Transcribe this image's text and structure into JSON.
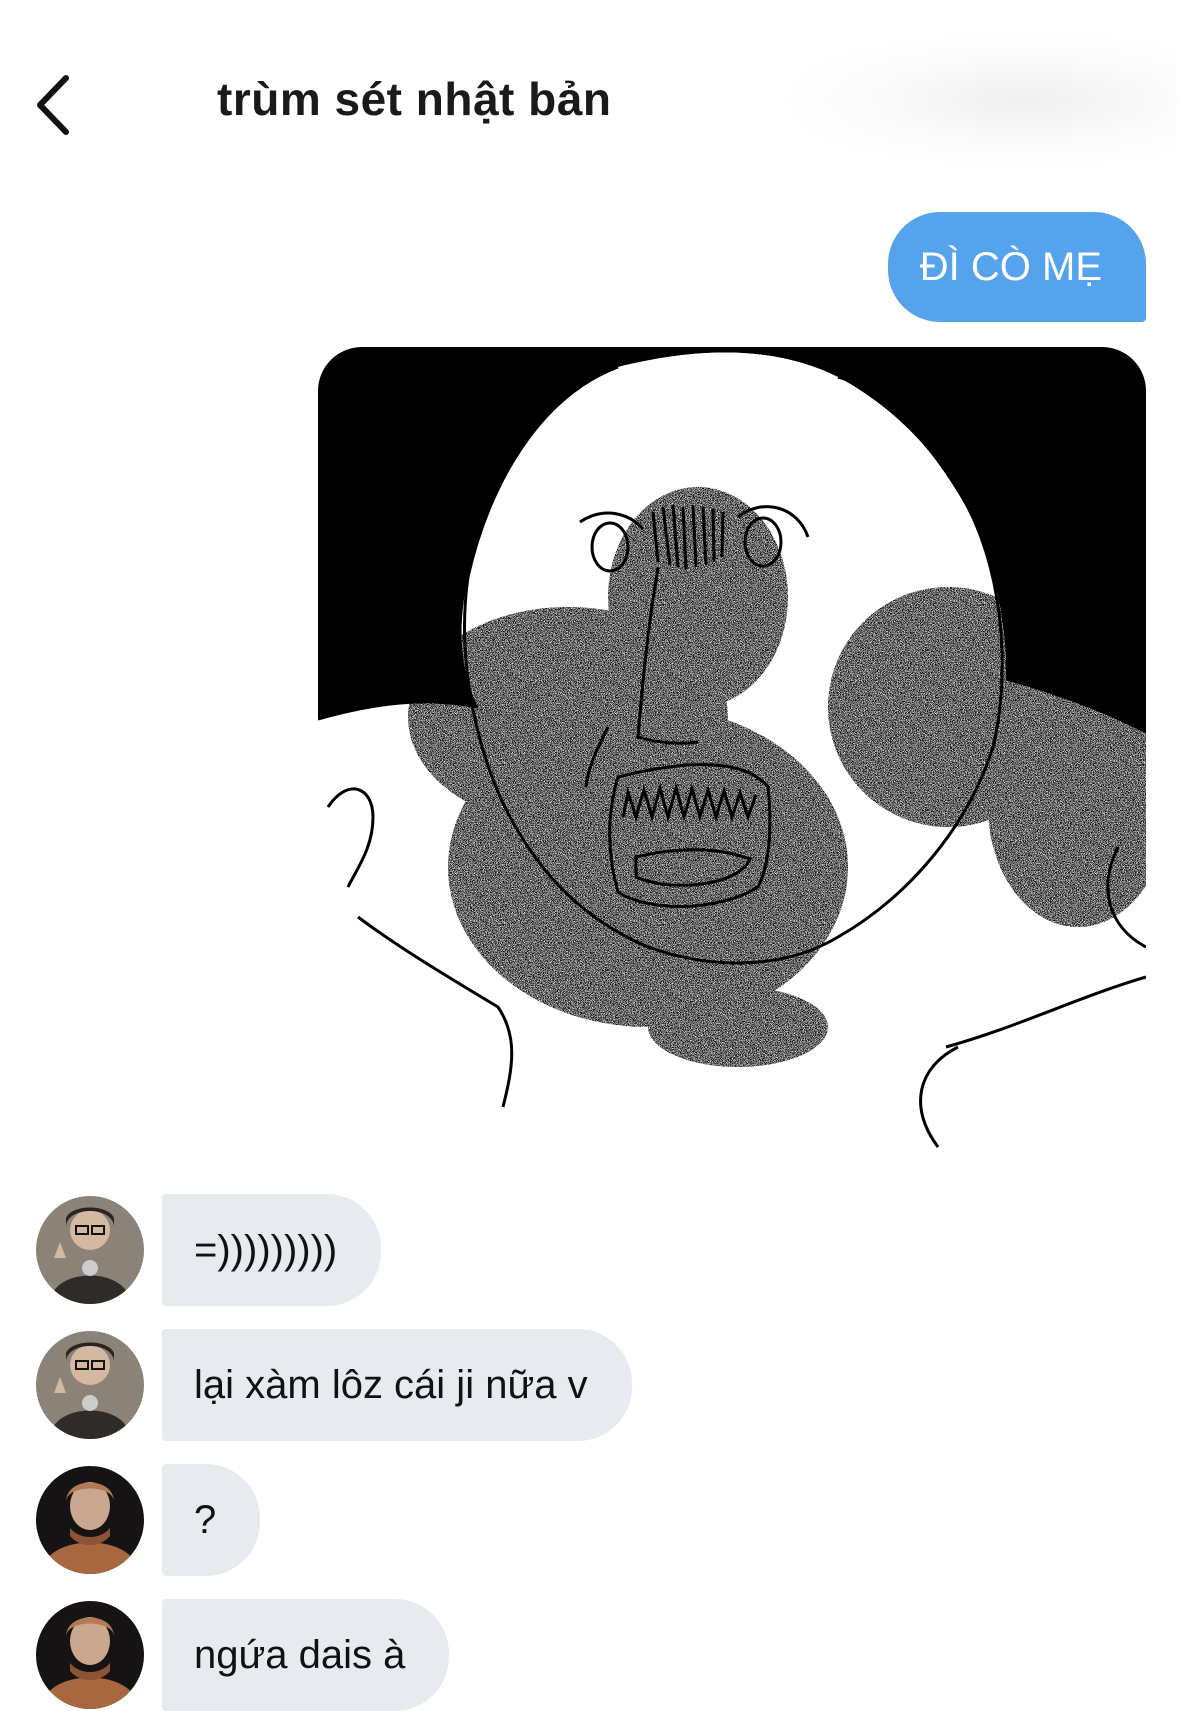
{
  "header": {
    "back_icon": "chevron-left-icon",
    "title": "trùm sét nhật bản"
  },
  "messages": {
    "outgoing_text": "ĐÌ CÒ MẸ",
    "outgoing_image": "meme-sticker",
    "incoming": [
      {
        "text": "=)))))))))",
        "avatar": "avatar-user-a"
      },
      {
        "text": "lại xàm lôz cái ji nữa v",
        "avatar": "avatar-user-a"
      },
      {
        "text": "?",
        "avatar": "avatar-user-b"
      },
      {
        "text": "ngứa dais à",
        "avatar": "avatar-user-b"
      }
    ]
  },
  "colors": {
    "outgoing_bubble": "#54a3ec",
    "incoming_bubble": "#e7ebef",
    "background": "#ffffff"
  }
}
